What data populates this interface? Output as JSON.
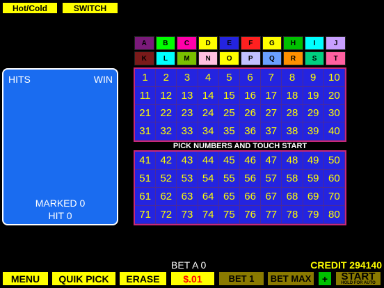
{
  "top_buttons": {
    "hotcold": "Hot/Cold",
    "switch": "SWITCH"
  },
  "letters_row1": [
    {
      "t": "A",
      "c": "#7a1a7a"
    },
    {
      "t": "B",
      "c": "#00ff00"
    },
    {
      "t": "C",
      "c": "#ff00aa"
    },
    {
      "t": "D",
      "c": "#ffff00"
    },
    {
      "t": "E",
      "c": "#2424e0"
    },
    {
      "t": "F",
      "c": "#ff2020"
    },
    {
      "t": "G",
      "c": "#ffff00"
    },
    {
      "t": "H",
      "c": "#00c000"
    },
    {
      "t": "I",
      "c": "#00ffff"
    },
    {
      "t": "J",
      "c": "#c8a0ff"
    }
  ],
  "letters_row2": [
    {
      "t": "K",
      "c": "#7a1a1a"
    },
    {
      "t": "L",
      "c": "#00ffff"
    },
    {
      "t": "M",
      "c": "#7ac000"
    },
    {
      "t": "N",
      "c": "#ffc0e0"
    },
    {
      "t": "O",
      "c": "#ffff00"
    },
    {
      "t": "P",
      "c": "#c0c0ff"
    },
    {
      "t": "Q",
      "c": "#6aa0ff"
    },
    {
      "t": "R",
      "c": "#ff9000"
    },
    {
      "t": "S",
      "c": "#00d080"
    },
    {
      "t": "T",
      "c": "#ff60a0"
    }
  ],
  "pick_message": "PICK NUMBERS AND TOUCH START",
  "hit_panel": {
    "hits_label": "HITS",
    "win_label": "WIN",
    "marked": "MARKED 0",
    "hit": "HIT 0"
  },
  "bet_text": "BET A 0",
  "credit_text": "CREDIT 294140",
  "bottom": {
    "menu": "MENU",
    "quikpick": "QUIK PICK",
    "erase": "ERASE",
    "denom": "$.01",
    "bet1": "BET 1",
    "betmax": "BET MAX",
    "plus": "+",
    "start": "START",
    "start_sub": "HOLD FOR AUTO"
  }
}
